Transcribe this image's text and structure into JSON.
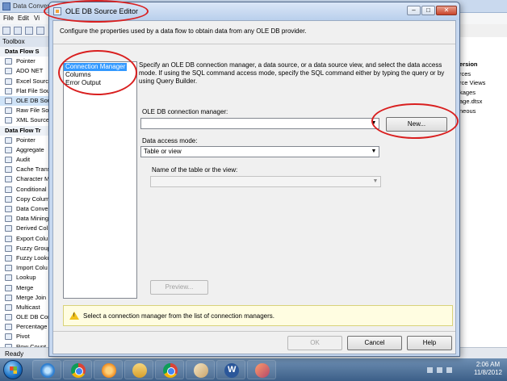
{
  "background_app": {
    "title": "Data Conver",
    "menu": [
      "File",
      "Edit",
      "Vi"
    ],
    "toolbox_header": "Toolbox",
    "toolbox_items": [
      {
        "label": "Data Flow S",
        "group": true
      },
      {
        "label": "Pointer"
      },
      {
        "label": "ADO NET"
      },
      {
        "label": "Excel Source"
      },
      {
        "label": "Flat File Sou"
      },
      {
        "label": "OLE DB Sou",
        "selected": true
      },
      {
        "label": "Raw File Sou"
      },
      {
        "label": "XML Source"
      },
      {
        "label": "Data Flow Tr",
        "group": true
      },
      {
        "label": "Pointer"
      },
      {
        "label": "Aggregate"
      },
      {
        "label": "Audit"
      },
      {
        "label": "Cache Trans"
      },
      {
        "label": "Character M"
      },
      {
        "label": "Conditional"
      },
      {
        "label": "Copy Colum"
      },
      {
        "label": "Data Conve"
      },
      {
        "label": "Data Mining"
      },
      {
        "label": "Derived Col"
      },
      {
        "label": "Export Colu"
      },
      {
        "label": "Fuzzy Group"
      },
      {
        "label": "Fuzzy Looku"
      },
      {
        "label": "Import Colu"
      },
      {
        "label": "Lookup"
      },
      {
        "label": "Merge"
      },
      {
        "label": "Merge Join"
      },
      {
        "label": "Multicast"
      },
      {
        "label": "OLE DB Cor"
      },
      {
        "label": "Percentage"
      },
      {
        "label": "Pivot"
      },
      {
        "label": "Row Count"
      }
    ],
    "right_pane_items": [
      "ersion",
      "rces",
      "rce Views",
      "kages",
      "age.dtsx",
      "neous"
    ],
    "status": "Ready"
  },
  "dialog": {
    "title": "OLE DB Source Editor",
    "description": "Configure the properties used by a data flow to obtain data from any OLE DB provider.",
    "nav_items": [
      "Connection Manager",
      "Columns",
      "Error Output"
    ],
    "instructions": "Specify an OLE DB connection manager, a data source, or a data source view, and select the data access mode. If using the SQL command access mode, specify the SQL command either by typing the query or by using Query Builder.",
    "connection_manager_label": "OLE DB connection manager:",
    "connection_manager_value": "",
    "new_button": "New...",
    "data_access_label": "Data access mode:",
    "data_access_value": "Table or view",
    "table_label": "Name of the table or the view:",
    "table_value": "",
    "preview_button": "Preview...",
    "warning": "Select a connection manager from the list of connection managers.",
    "ok": "OK",
    "cancel": "Cancel",
    "help": "Help",
    "window_buttons": {
      "minimize": "–",
      "maximize": "□",
      "close": "✕"
    }
  },
  "taskbar": {
    "time": "2:06 AM",
    "date": "11/8/2012"
  },
  "colors": {
    "annotation_red": "#d91f1f",
    "selection_blue": "#3399ff",
    "warning_yellow": "#fffde1"
  }
}
